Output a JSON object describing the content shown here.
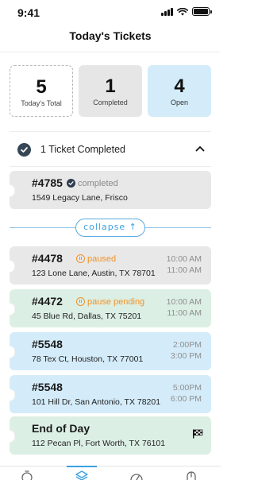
{
  "status_bar": {
    "time": "9:41"
  },
  "header": {
    "title": "Today's Tickets"
  },
  "stats": [
    {
      "value": "5",
      "label": "Today's Total"
    },
    {
      "value": "1",
      "label": "Completed"
    },
    {
      "value": "4",
      "label": "Open"
    }
  ],
  "completed_section": {
    "label": "1 Ticket Completed"
  },
  "completed_ticket": {
    "id": "#4785",
    "status": "completed",
    "address": "1549 Legacy Lane, Frisco"
  },
  "collapse": {
    "label": "collapse ↑"
  },
  "tickets": [
    {
      "id": "#4478",
      "status": "paused",
      "address": "123 Lone Lane, Austin, TX 78701",
      "start": "10:00 AM",
      "end": "11:00 AM"
    },
    {
      "id": "#4472",
      "status": "pause pending",
      "address": "45 Blue Rd, Dallas, TX 75201",
      "start": "10:00 AM",
      "end": "11:00 AM"
    },
    {
      "id": "#5548",
      "status": "",
      "address": "78 Tex Ct, Houston, TX 77001",
      "start": "2:00PM",
      "end": "3:00 PM"
    },
    {
      "id": "#5548",
      "status": "",
      "address": "101 Hill Dr, San Antonio, TX 78201",
      "start": "5:00PM",
      "end": "6:00 PM"
    }
  ],
  "end_of_day": {
    "title": "End of Day",
    "address": "112 Pecan Pl, Fort Worth, TX 76101"
  },
  "colors": {
    "accent": "#3aa0e0",
    "paused": "#f0932b",
    "open_bg": "#d4ecfa",
    "green_bg": "#dcefe4",
    "gray_bg": "#e8e8e8"
  }
}
